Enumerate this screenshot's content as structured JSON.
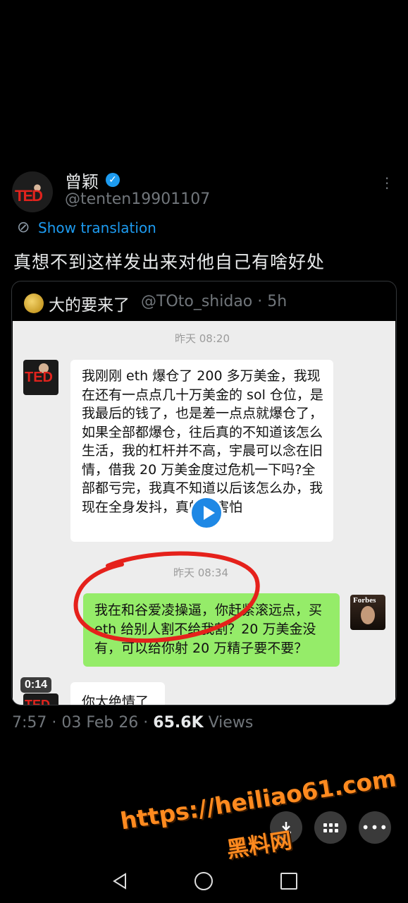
{
  "tweet": {
    "author_name": "曾颖",
    "handle": "@tenten19901107",
    "avatar_logo": "TED",
    "show_translation": "Show translation",
    "text": "真想不到这样发出来对他自己有啥好处",
    "meta_time": "7:57 · 03 Feb 26 · ",
    "views_count": "65.6K",
    "views_label": " Views"
  },
  "quote": {
    "name": "大的要来了",
    "handle_time": "@TOto_shidao · 5h",
    "video_duration": "0:14"
  },
  "chat": {
    "timestamp_1": "昨天 08:20",
    "message_1": "我刚刚 eth 爆仓了 200 多万美金，我现在还有一点点几十万美金的 sol 仓位，是我最后的钱了，也是差一点点就爆仓了，如果全部都爆仓，往后真的不知道该怎么生活，我的杠杆并不高，宇晨可以念在旧情，借我 20 万美金度过危机一下吗?全部都亏完，我真不知道以后该怎么办，我现在全身发抖，真的很害怕",
    "timestamp_2": "昨天 08:34",
    "message_2": "我在和谷爱凌操逼，你赶紧滚远点，买 eth 给别人割不给我割？20 万美金没有，可以给你射 20 万精子要不要？",
    "message_3": "你太绝情了",
    "right_avatar_text": "Forbes"
  },
  "overlay": {
    "watermark_url": "https://heiliao61.com",
    "watermark_name": "黑料网"
  },
  "colors": {
    "accent": "#1d9bf0",
    "wechat_green": "#95ec69",
    "annotation_red": "#e5211b",
    "watermark_orange": "#ff8a1f"
  },
  "icons": [
    "verified-badge-icon",
    "more-vertical-icon",
    "translate-icon",
    "play-icon",
    "download-icon",
    "grid-icon",
    "more-horizontal-icon",
    "back-icon",
    "home-icon",
    "recents-icon"
  ]
}
